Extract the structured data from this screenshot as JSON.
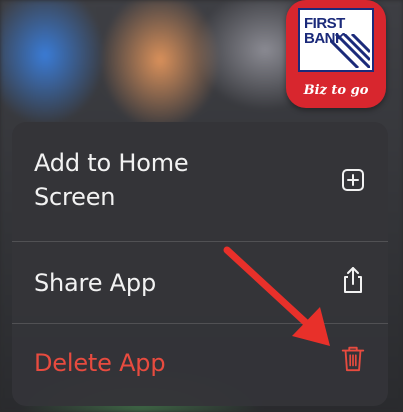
{
  "app": {
    "logo_line1": "FIRST",
    "logo_line2": "BANK",
    "tagline": "Biz to go",
    "brand_color": "#d8262e",
    "logo_text_color": "#1b2a7a"
  },
  "menu": {
    "items": [
      {
        "label": "Add to Home Screen",
        "icon": "plus-square-icon"
      },
      {
        "label": "Share App",
        "icon": "share-icon"
      },
      {
        "label": "Delete App",
        "icon": "trash-icon",
        "destructive": true
      }
    ],
    "destructive_color": "#e84b3f",
    "annotation_arrow_color": "#e8302a"
  }
}
